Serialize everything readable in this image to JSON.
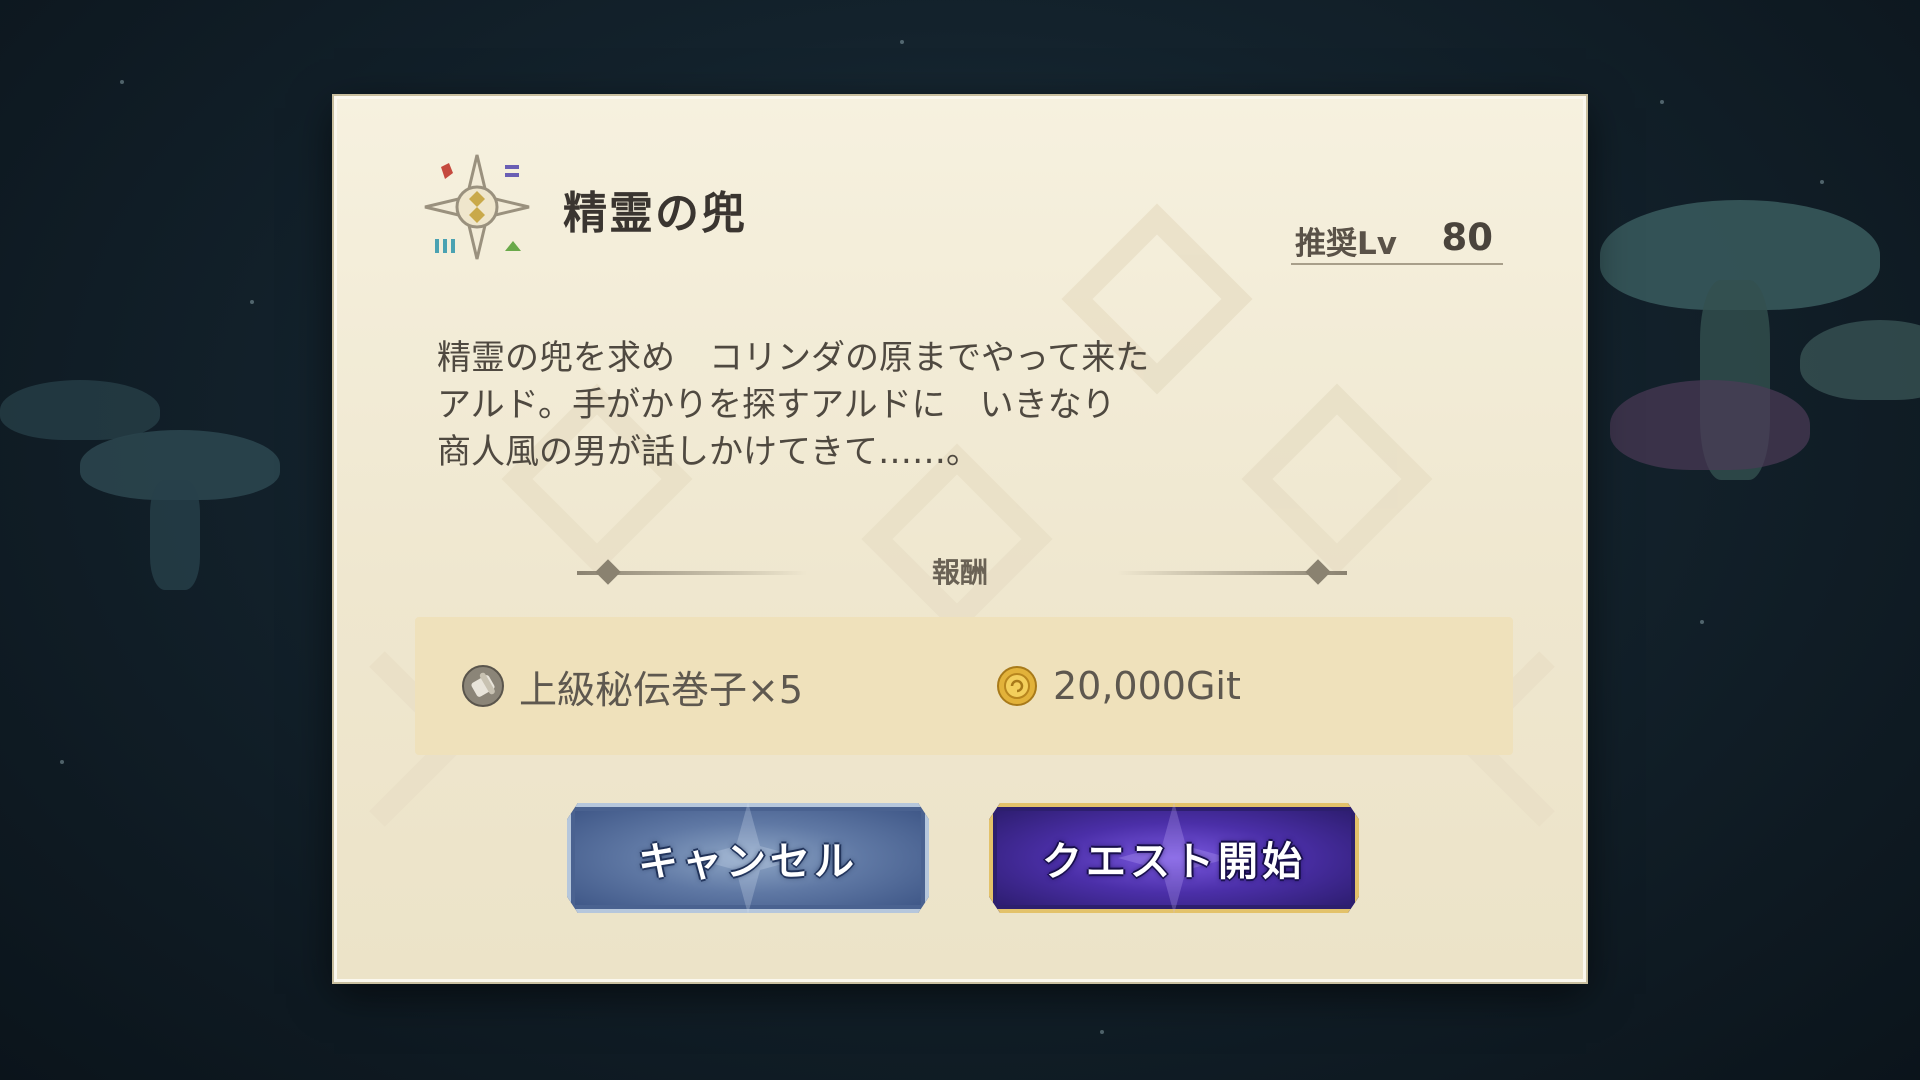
{
  "quest": {
    "title": "精霊の兜",
    "level_label": "推奨Lv",
    "level_value": "80",
    "description": [
      "精霊の兜を求め　コリンダの原までやって来た",
      "アルド。手がかりを探すアルドに　いきなり",
      "商人風の男が話しかけてきて……。"
    ]
  },
  "rewards": {
    "header": "報酬",
    "items": [
      {
        "icon": "scroll-icon",
        "label": "上級秘伝巻子×5"
      },
      {
        "icon": "gold-coin-icon",
        "label": "20,000Git"
      }
    ]
  },
  "buttons": {
    "cancel": "キャンセル",
    "start": "クエスト開始"
  },
  "colors": {
    "dialog_bg": "#f6f1df",
    "reward_panel": "#efe1bb",
    "cancel_button": "#5f78a4",
    "start_button": "#4b2fa8",
    "start_border": "#e3c26a"
  }
}
